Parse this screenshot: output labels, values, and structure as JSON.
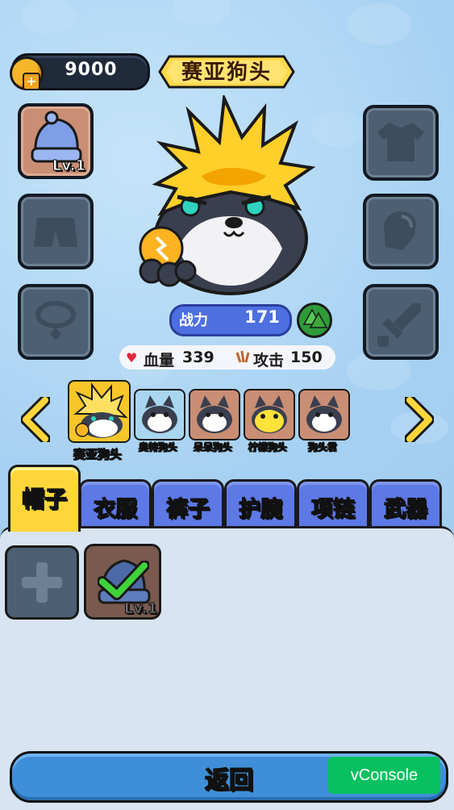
{
  "currency": {
    "value": "9000",
    "icon": "paw-coin-icon",
    "add_icon": "plus-icon"
  },
  "title": "赛亚狗头",
  "equipment_slots": {
    "left": [
      {
        "name": "hat",
        "icon": "beanie-hat-icon",
        "level": "Lv.1",
        "equipped": true
      },
      {
        "name": "pants",
        "icon": "shorts-icon",
        "equipped": false
      },
      {
        "name": "necklace",
        "icon": "necklace-icon",
        "equipped": false
      }
    ],
    "right": [
      {
        "name": "clothes",
        "icon": "shirt-icon",
        "equipped": false
      },
      {
        "name": "bracer",
        "icon": "glove-icon",
        "equipped": false
      },
      {
        "name": "weapon",
        "icon": "sword-icon",
        "equipped": false
      }
    ]
  },
  "power": {
    "label": "战力",
    "value": "171",
    "icon": "tree-icon"
  },
  "stats": {
    "hp": {
      "icon": "heart-icon",
      "label": "血量",
      "value": "339"
    },
    "attack": {
      "icon": "claw-icon",
      "label": "攻击",
      "value": "150"
    }
  },
  "characters": [
    {
      "name": "赛亚狗头",
      "selected": true,
      "bg": "#f9c62a"
    },
    {
      "name": "奥特狗头",
      "selected": false,
      "bg": "#a8d6ef"
    },
    {
      "name": "呆呆狗头",
      "selected": false,
      "bg": "#c98e74"
    },
    {
      "name": "柠檬狗头",
      "selected": false,
      "bg": "#c98e74"
    },
    {
      "name": "狗头君",
      "selected": false,
      "bg": "#c98e74"
    }
  ],
  "tabs": [
    {
      "label": "帽子",
      "active": true
    },
    {
      "label": "衣服",
      "active": false
    },
    {
      "label": "裤子",
      "active": false
    },
    {
      "label": "护腕",
      "active": false
    },
    {
      "label": "项链",
      "active": false
    },
    {
      "label": "武器",
      "active": false
    }
  ],
  "inventory": [
    {
      "type": "empty",
      "icon": "plus-icon"
    },
    {
      "type": "item",
      "icon": "beanie-hat-icon",
      "level": "Lv.1",
      "equipped_icon": "checkmark-icon"
    }
  ],
  "back_button": {
    "label": "返回"
  },
  "vconsole": {
    "label": "vConsole"
  },
  "colors": {
    "accent": "#ffd63a",
    "tab": "#5d79e6",
    "button": "#3f8fd8",
    "vconsole": "#07c160"
  }
}
